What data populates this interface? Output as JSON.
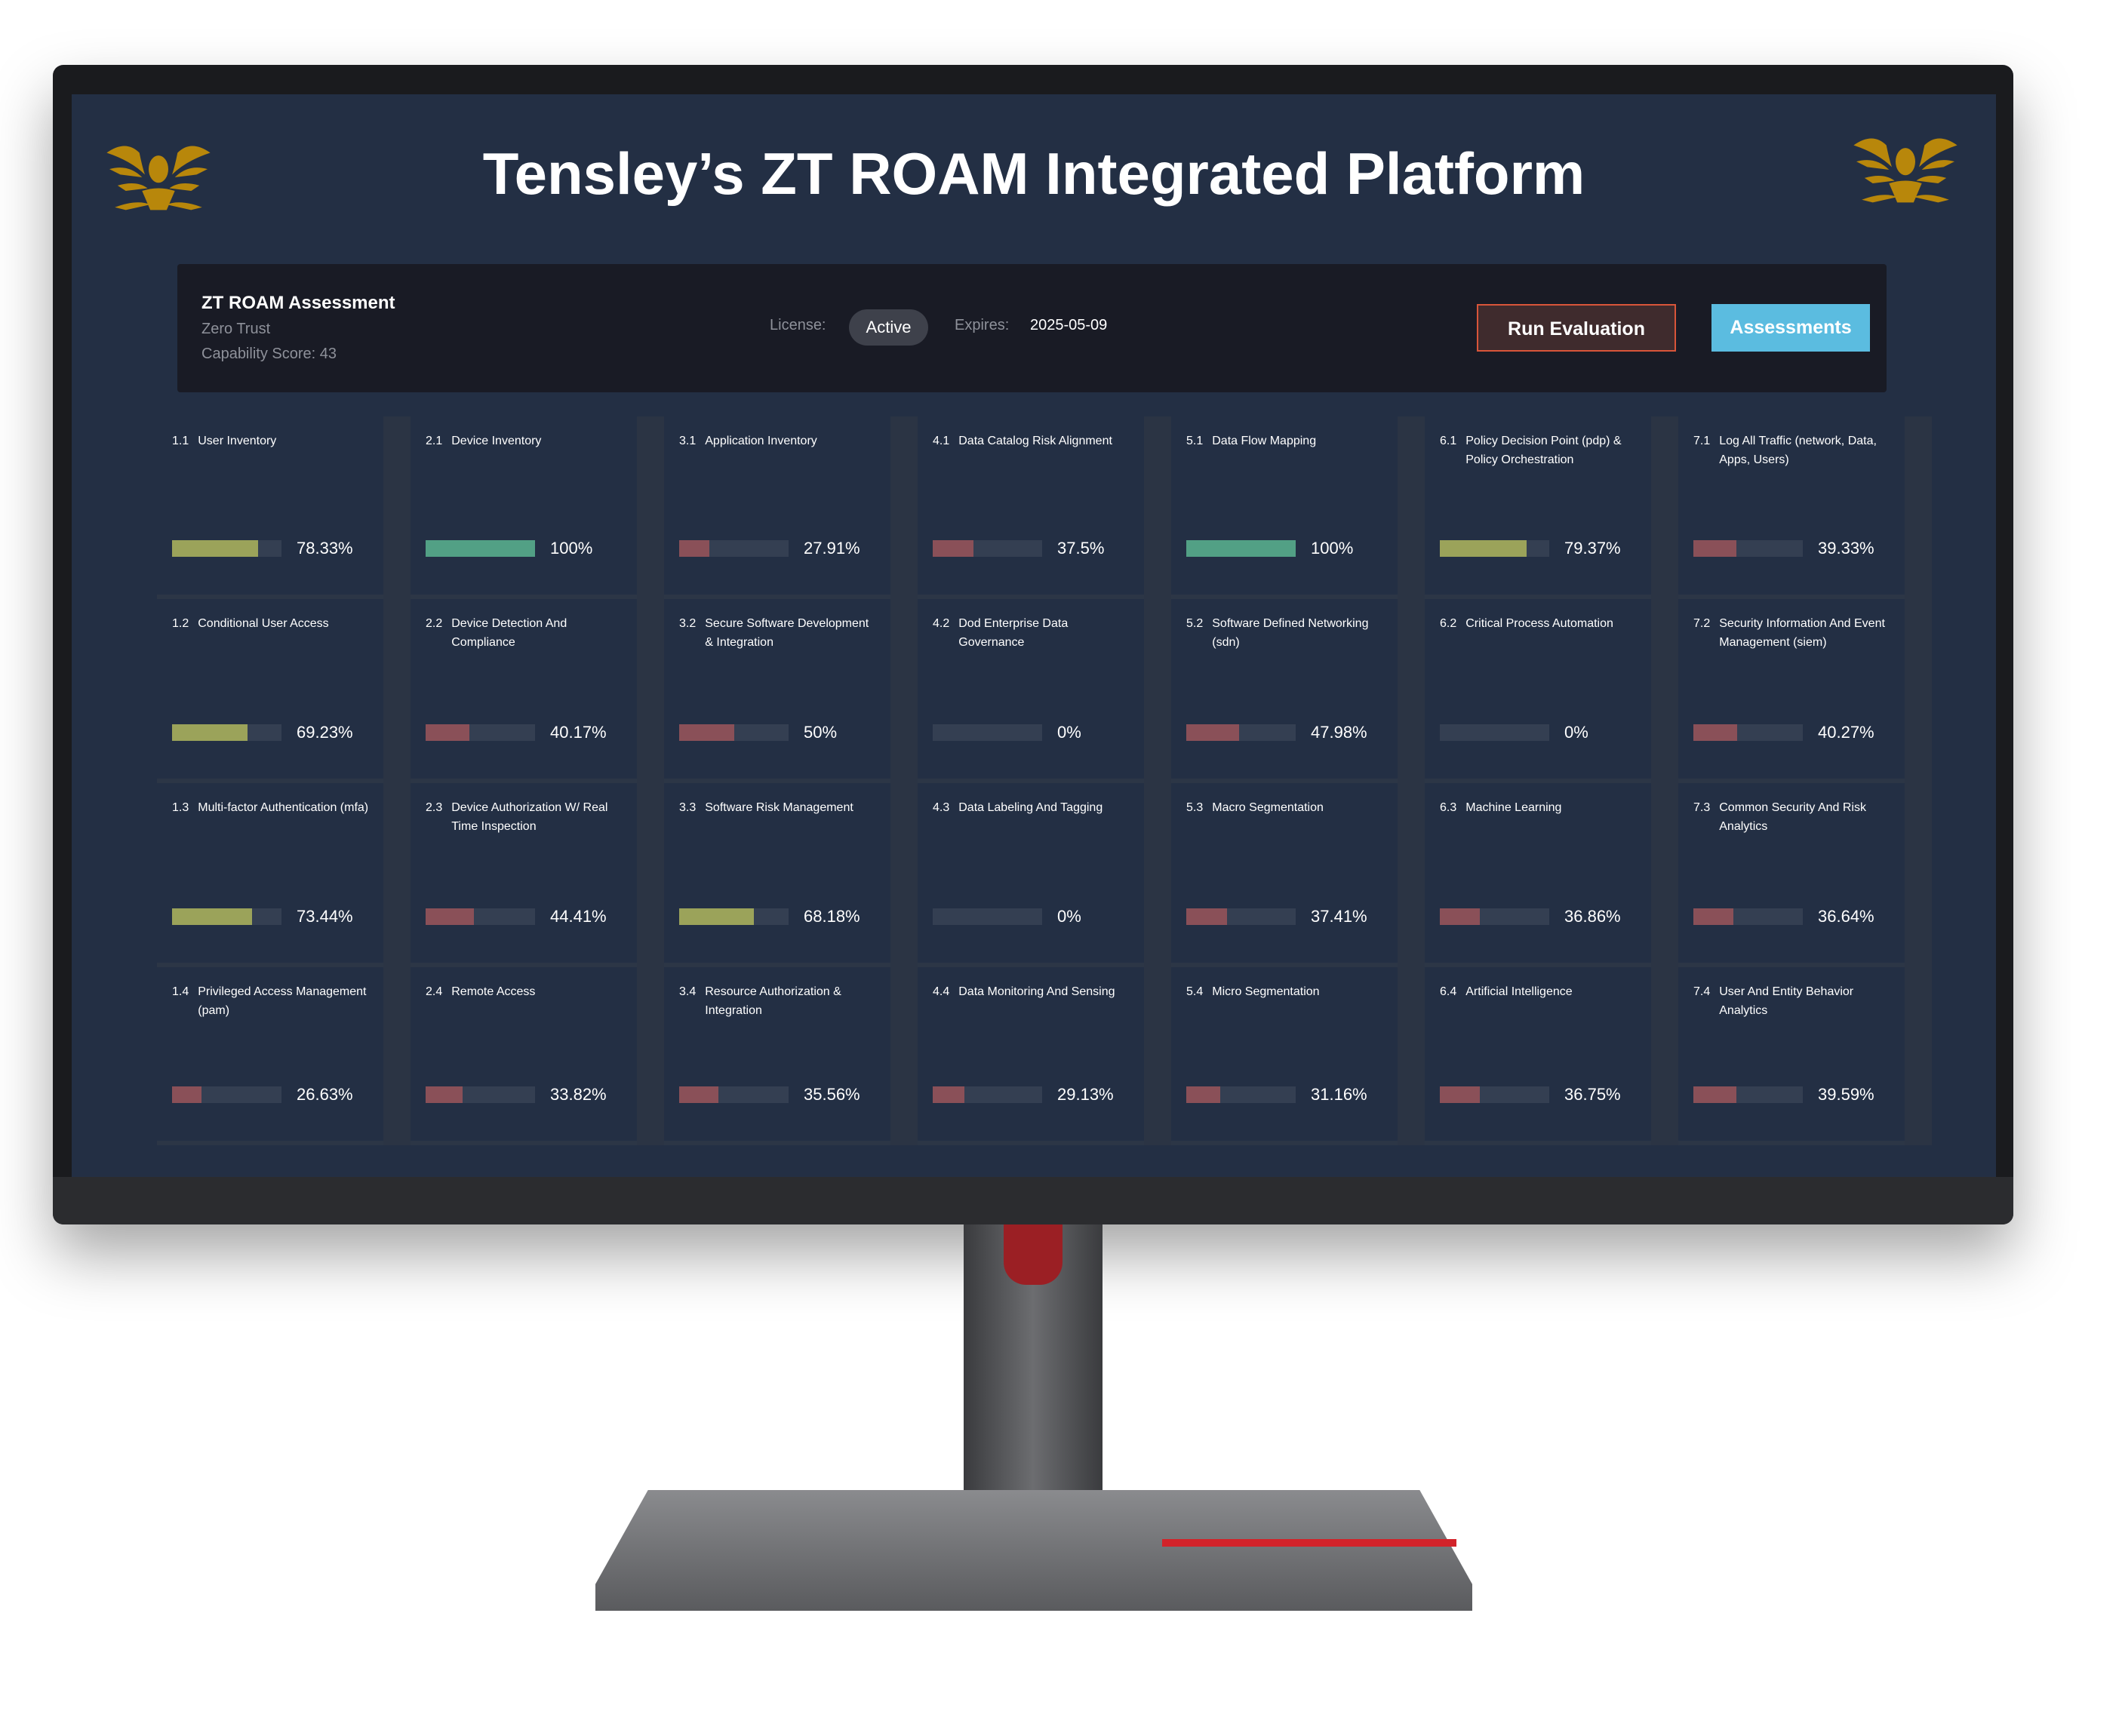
{
  "header": {
    "title": "Tensley’s ZT ROAM Integrated Platform"
  },
  "panel": {
    "title": "ZT ROAM Assessment",
    "subtitle": "Zero Trust",
    "score": "Capability Score: 43",
    "license_label": "License:",
    "license_value": "Active",
    "expires_label": "Expires:",
    "expires_value": "2025-05-09",
    "run_label": "Run Evaluation",
    "assess_label": "Assessments"
  },
  "colors": {
    "high": "#52a085",
    "mid": "#9ba35a",
    "low": "#8a5058",
    "track": "#343f52",
    "accent": "#5bbce0",
    "logo": "#b8870b"
  },
  "cells": [
    [
      {
        "num": "1.1",
        "label": "User Inventory",
        "pct": 78.33,
        "text": "78.33%"
      },
      {
        "num": "2.1",
        "label": "Device Inventory",
        "pct": 100,
        "text": "100%"
      },
      {
        "num": "3.1",
        "label": "Application Inventory",
        "pct": 27.91,
        "text": "27.91%"
      },
      {
        "num": "4.1",
        "label": "Data Catalog Risk Alignment",
        "pct": 37.5,
        "text": "37.5%"
      },
      {
        "num": "5.1",
        "label": "Data Flow Mapping",
        "pct": 100,
        "text": "100%"
      },
      {
        "num": "6.1",
        "label": "Policy Decision Point (pdp) & Policy Orchestration",
        "pct": 79.37,
        "text": "79.37%"
      },
      {
        "num": "7.1",
        "label": "Log All Traffic (network, Data, Apps, Users)",
        "pct": 39.33,
        "text": "39.33%"
      }
    ],
    [
      {
        "num": "1.2",
        "label": "Conditional User Access",
        "pct": 69.23,
        "text": "69.23%"
      },
      {
        "num": "2.2",
        "label": "Device Detection And Compliance",
        "pct": 40.17,
        "text": "40.17%"
      },
      {
        "num": "3.2",
        "label": "Secure Software Development & Integration",
        "pct": 50,
        "text": "50%"
      },
      {
        "num": "4.2",
        "label": "Dod Enterprise Data Governance",
        "pct": 0,
        "text": "0%"
      },
      {
        "num": "5.2",
        "label": "Software Defined Networking (sdn)",
        "pct": 47.98,
        "text": "47.98%"
      },
      {
        "num": "6.2",
        "label": "Critical Process Automation",
        "pct": 0,
        "text": "0%"
      },
      {
        "num": "7.2",
        "label": "Security Information And Event Management (siem)",
        "pct": 40.27,
        "text": "40.27%"
      }
    ],
    [
      {
        "num": "1.3",
        "label": "Multi-factor Authentication (mfa)",
        "pct": 73.44,
        "text": "73.44%"
      },
      {
        "num": "2.3",
        "label": "Device Authorization W/ Real Time Inspection",
        "pct": 44.41,
        "text": "44.41%"
      },
      {
        "num": "3.3",
        "label": "Software Risk Management",
        "pct": 68.18,
        "text": "68.18%"
      },
      {
        "num": "4.3",
        "label": "Data Labeling And Tagging",
        "pct": 0,
        "text": "0%"
      },
      {
        "num": "5.3",
        "label": "Macro Segmentation",
        "pct": 37.41,
        "text": "37.41%"
      },
      {
        "num": "6.3",
        "label": "Machine Learning",
        "pct": 36.86,
        "text": "36.86%"
      },
      {
        "num": "7.3",
        "label": "Common Security And Risk Analytics",
        "pct": 36.64,
        "text": "36.64%"
      }
    ],
    [
      {
        "num": "1.4",
        "label": "Privileged Access Management (pam)",
        "pct": 26.63,
        "text": "26.63%"
      },
      {
        "num": "2.4",
        "label": "Remote Access",
        "pct": 33.82,
        "text": "33.82%"
      },
      {
        "num": "3.4",
        "label": "Resource Authorization & Integration",
        "pct": 35.56,
        "text": "35.56%"
      },
      {
        "num": "4.4",
        "label": "Data Monitoring And Sensing",
        "pct": 29.13,
        "text": "29.13%"
      },
      {
        "num": "5.4",
        "label": "Micro Segmentation",
        "pct": 31.16,
        "text": "31.16%"
      },
      {
        "num": "6.4",
        "label": "Artificial Intelligence",
        "pct": 36.75,
        "text": "36.75%"
      },
      {
        "num": "7.4",
        "label": "User And Entity Behavior Analytics",
        "pct": 39.59,
        "text": "39.59%"
      }
    ]
  ]
}
